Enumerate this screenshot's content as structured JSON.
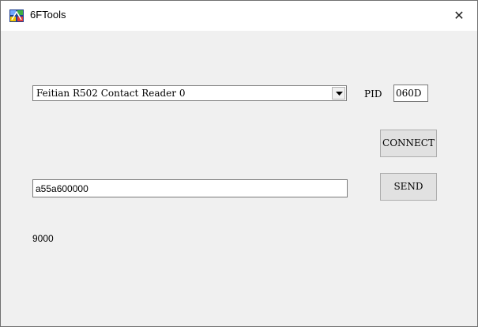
{
  "window": {
    "title": "6FTools",
    "close_glyph": "✕",
    "app_icon": "app-logo-icon",
    "close_icon": "close-icon"
  },
  "reader": {
    "selected": "Feitian R502 Contact Reader 0",
    "dropdown_icon": "chevron-down-icon"
  },
  "pid": {
    "label": "PID",
    "value": "060D"
  },
  "buttons": {
    "connect_label": "CONNECT",
    "send_label": "SEND"
  },
  "command": {
    "value": "a55a600000"
  },
  "response": {
    "text": "9000"
  },
  "colors": {
    "client_bg": "#f0f0f0",
    "titlebar_bg": "#ffffff",
    "button_bg": "#e1e1e1"
  }
}
